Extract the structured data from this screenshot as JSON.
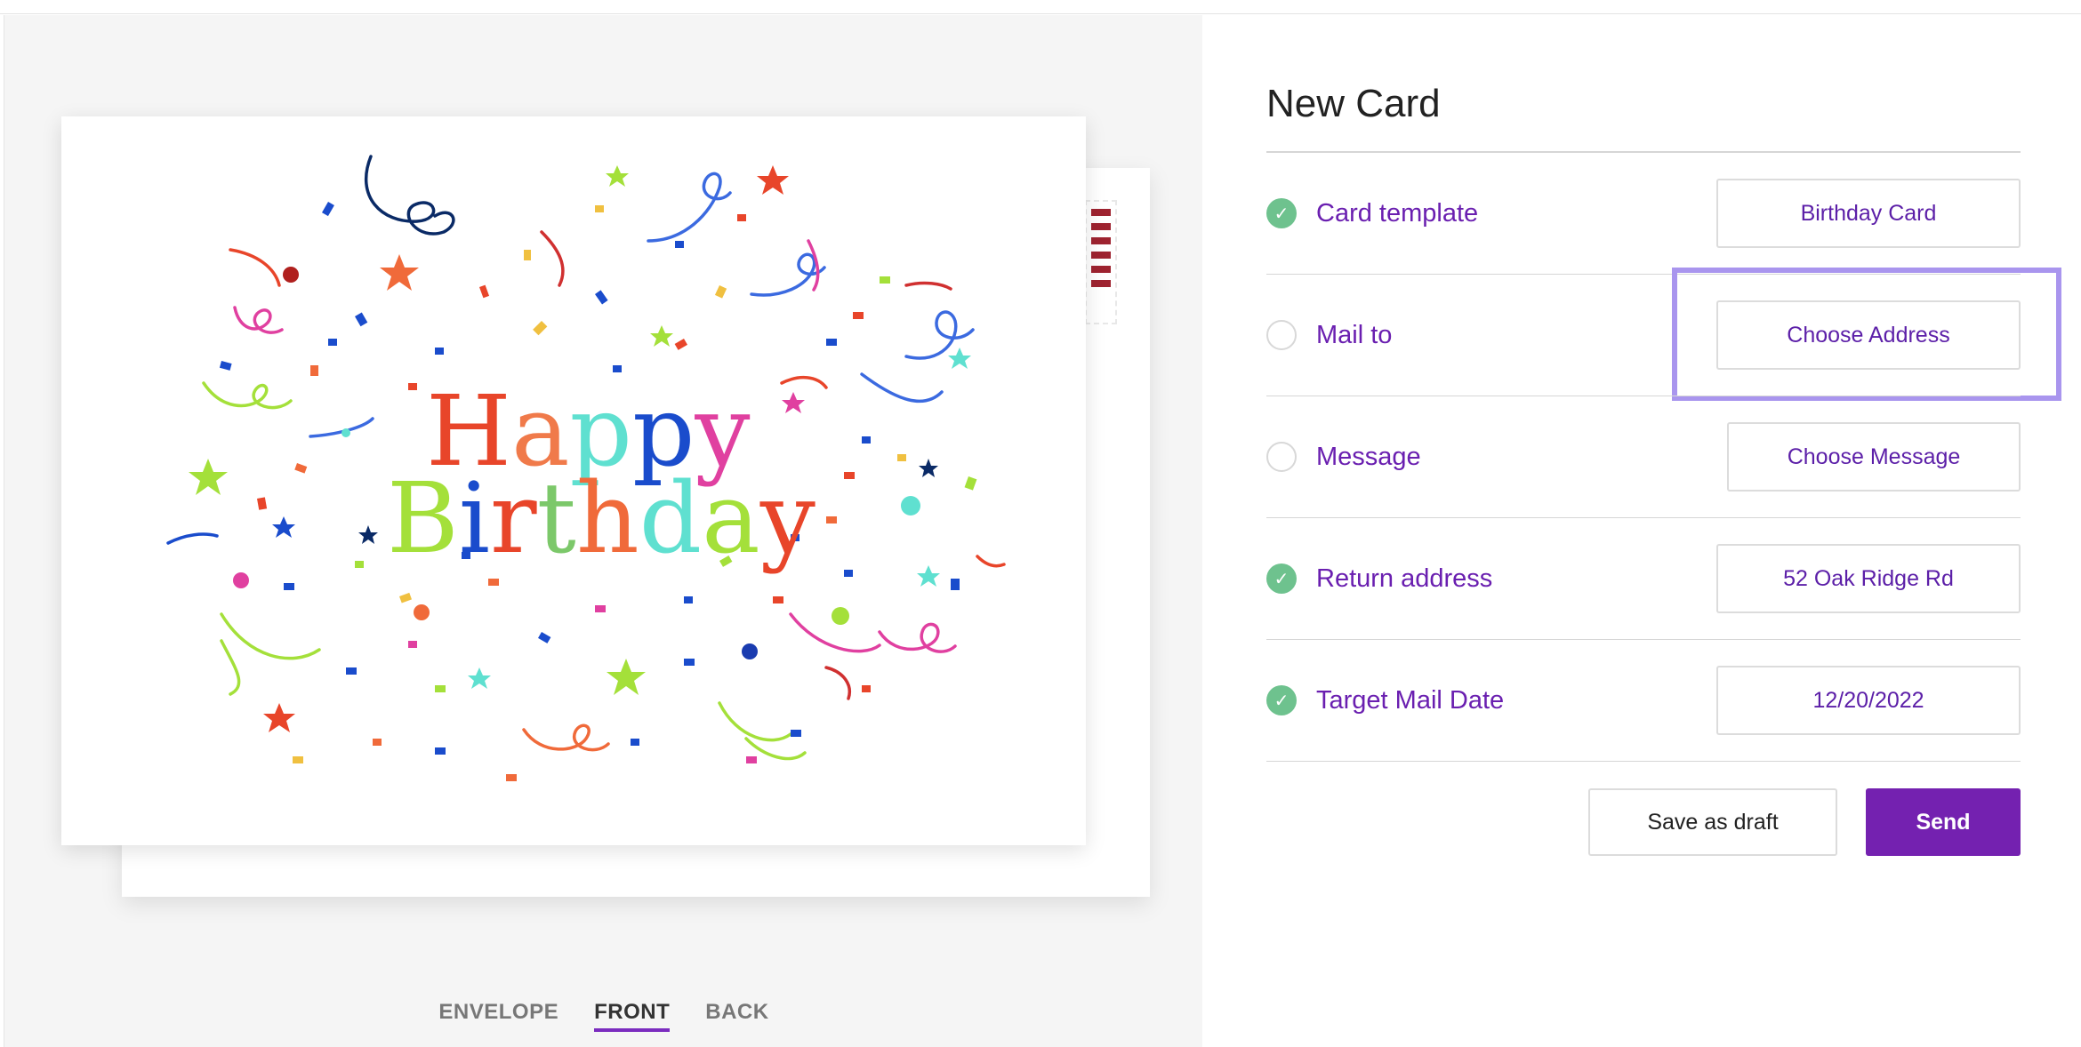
{
  "preview": {
    "card_text_line1": "Happy",
    "card_text_line2": "Birthday",
    "tabs": [
      {
        "label": "ENVELOPE",
        "active": false
      },
      {
        "label": "FRONT",
        "active": true
      },
      {
        "label": "BACK",
        "active": false
      }
    ]
  },
  "form": {
    "title": "New Card",
    "rows": [
      {
        "label": "Card template",
        "status": "complete",
        "value": "Birthday Card"
      },
      {
        "label": "Mail to",
        "status": "incomplete",
        "value": "Choose Address"
      },
      {
        "label": "Message",
        "status": "incomplete",
        "value": "Choose Message"
      },
      {
        "label": "Return address",
        "status": "complete",
        "value": "52 Oak Ridge Rd"
      },
      {
        "label": "Target Mail Date",
        "status": "complete",
        "value": "12/20/2022"
      }
    ],
    "actions": {
      "draft_label": "Save as draft",
      "send_label": "Send"
    }
  },
  "colors": {
    "accent": "#7421b0",
    "label_text": "#6a1fb0",
    "complete_check": "#6ec28e",
    "highlight_box": "#a995ee"
  },
  "icons": {
    "complete": "check-circle-icon",
    "incomplete": "empty-circle-icon"
  }
}
